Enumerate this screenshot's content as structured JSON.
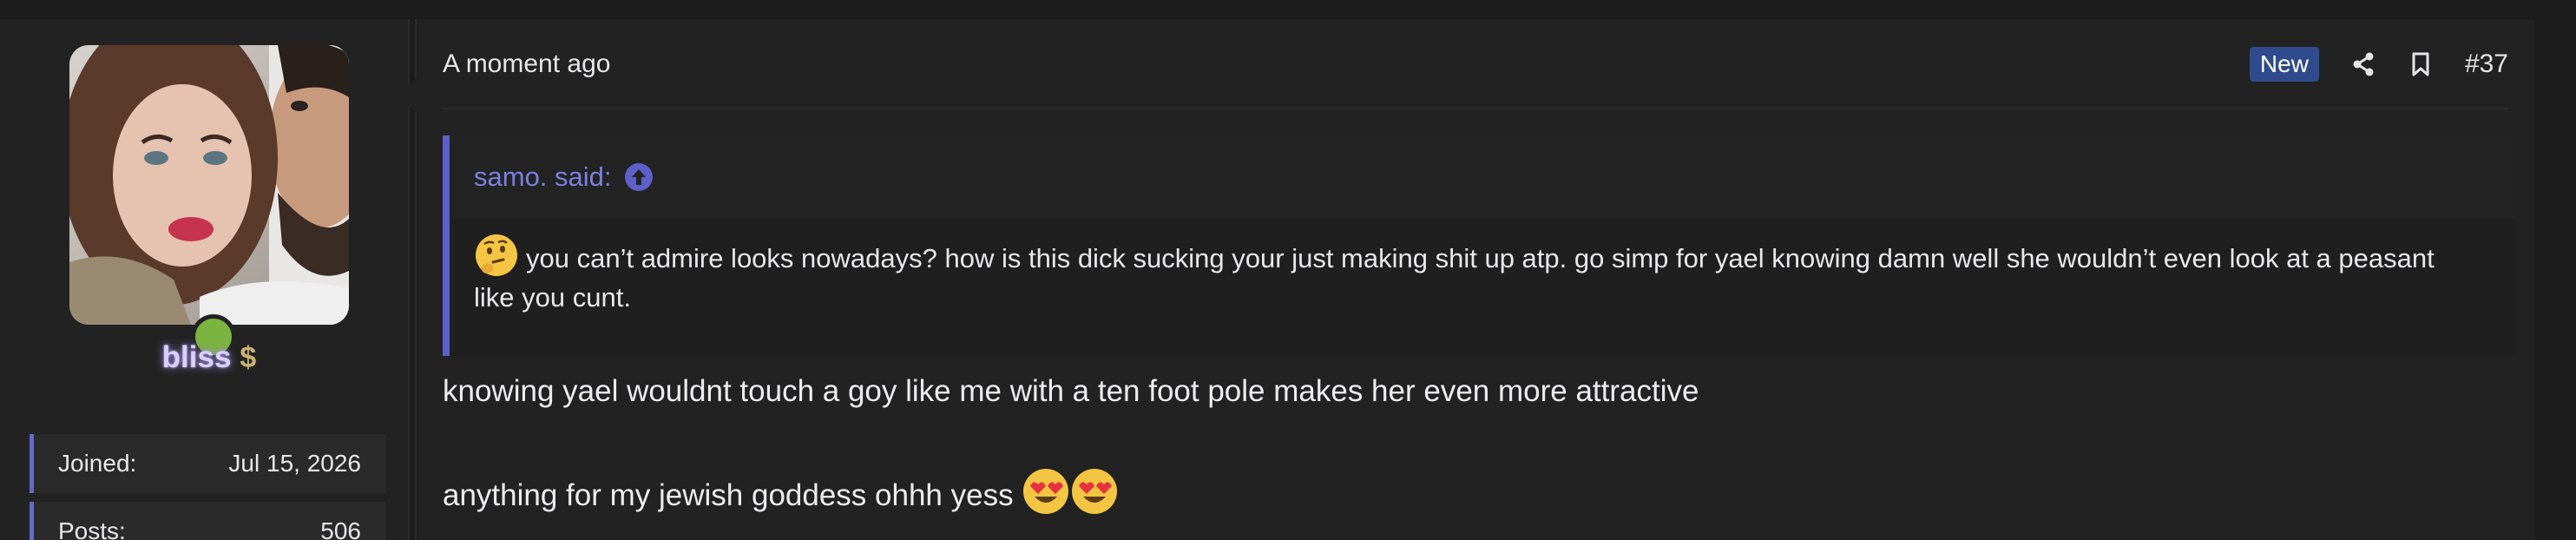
{
  "user": {
    "name": "bliss",
    "flair_icon": "dollar-sign-icon",
    "online": true,
    "stats": [
      {
        "label": "Joined:",
        "value": "Jul 15, 2026"
      },
      {
        "label": "Posts:",
        "value": "506"
      }
    ]
  },
  "post": {
    "time": "A moment ago",
    "badge": "New",
    "number": "#37",
    "share_icon": "share-icon",
    "bookmark_icon": "bookmark-icon"
  },
  "quote": {
    "attribution": "samo. said:",
    "emoji": "🤔",
    "text": "you can’t admire looks nowadays? how is this dick sucking your just making shit up atp. go simp for yael knowing damn well she wouldn’t even look at a peasant like you cunt."
  },
  "message": {
    "line1": "knowing yael wouldnt touch a goy like me with a ten foot pole makes her even more attractive",
    "line2": "anything for my jewish goddess ohhh yess",
    "emojis": "😍😍"
  },
  "colors": {
    "accent": "#5c60c8",
    "badge_bg": "#2f4b8d",
    "online": "#7bb33f",
    "background": "#1c1c1d",
    "panel": "#222223"
  }
}
